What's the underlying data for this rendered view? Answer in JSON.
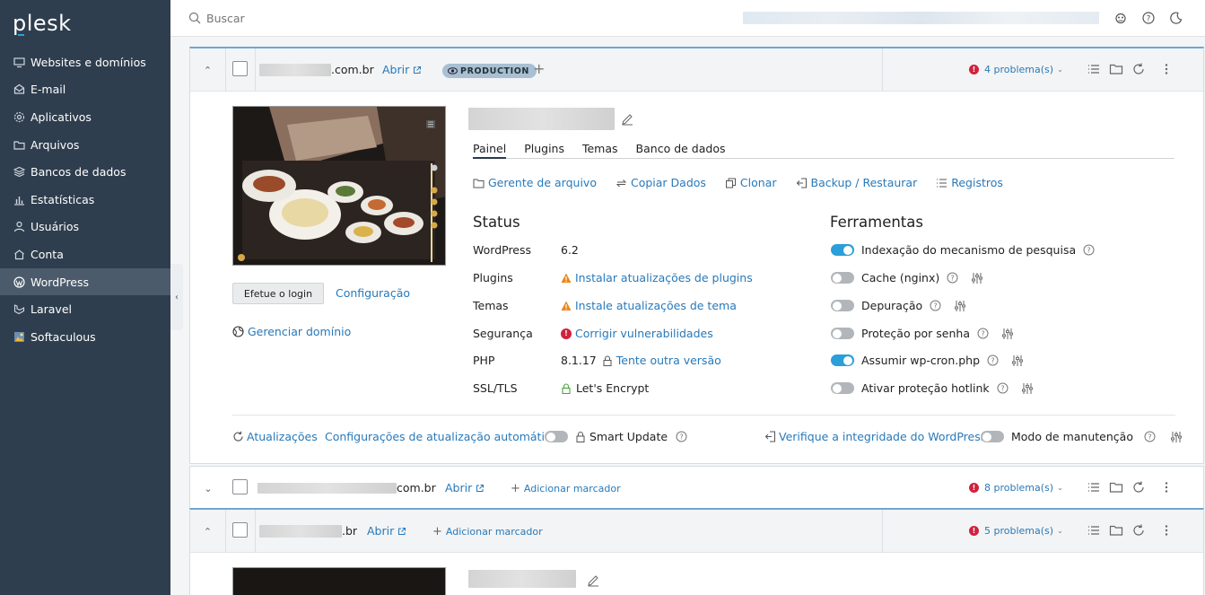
{
  "sidebar": {
    "logo": "plesk",
    "items": [
      {
        "label": "Websites e domínios",
        "icon": "monitor-icon"
      },
      {
        "label": "E-mail",
        "icon": "mail-icon"
      },
      {
        "label": "Aplicativos",
        "icon": "gear-icon"
      },
      {
        "label": "Arquivos",
        "icon": "folder-icon"
      },
      {
        "label": "Bancos de dados",
        "icon": "database-icon"
      },
      {
        "label": "Estatísticas",
        "icon": "bar-chart-icon"
      },
      {
        "label": "Usuários",
        "icon": "user-icon"
      },
      {
        "label": "Conta",
        "icon": "account-icon"
      },
      {
        "label": "WordPress",
        "icon": "wordpress-icon",
        "active": true
      },
      {
        "label": "Laravel",
        "icon": "laravel-icon"
      },
      {
        "label": "Softaculous",
        "icon": "softaculous-icon"
      }
    ]
  },
  "topbar": {
    "search_placeholder": "Buscar"
  },
  "site1": {
    "domain_suffix": ".com.br",
    "open_label": "Abrir",
    "badge": "PRODUCTION",
    "problems": "4 problema(s)",
    "login_button": "Efetue o login",
    "config_link": "Configuração",
    "manage_domain": "Gerenciar domínio",
    "tabs": [
      "Painel",
      "Plugins",
      "Temas",
      "Banco de dados"
    ],
    "actions": [
      "Gerente de arquivo",
      "Copiar Dados",
      "Clonar",
      "Backup / Restaurar",
      "Registros"
    ],
    "status": {
      "title": "Status",
      "rows": [
        {
          "label": "WordPress",
          "value": "6.2"
        },
        {
          "label": "Plugins",
          "value": "Instalar atualizações de plugins"
        },
        {
          "label": "Temas",
          "value": "Instale atualizações de tema"
        },
        {
          "label": "Segurança",
          "value": "Corrigir vulnerabilidades"
        },
        {
          "label": "PHP",
          "value": "8.1.17",
          "link": "Tente outra versão"
        },
        {
          "label": "SSL/TLS",
          "value": "Let's Encrypt"
        }
      ]
    },
    "tools": {
      "title": "Ferramentas",
      "rows": [
        {
          "label": "Indexação do mecanismo de pesquisa",
          "on": true
        },
        {
          "label": "Cache (nginx)",
          "on": false
        },
        {
          "label": "Depuração",
          "on": false
        },
        {
          "label": "Proteção por senha",
          "on": false
        },
        {
          "label": "Assumir wp-cron.php",
          "on": true
        },
        {
          "label": "Ativar proteção hotlink",
          "on": false
        }
      ]
    },
    "footer": {
      "updates": "Atualizações",
      "auto_update": "Configurações de atualização automática",
      "smart_update": "Smart Update",
      "integrity": "Verifique a integridade do WordPress",
      "maintenance": "Modo de manutenção"
    }
  },
  "site2": {
    "domain_suffix": "com.br",
    "open_label": "Abrir",
    "add_tag": "Adicionar marcador",
    "problems": "8 problema(s)"
  },
  "site3": {
    "domain_suffix": ".br",
    "open_label": "Abrir",
    "add_tag": "Adicionar marcador",
    "problems": "5 problema(s)"
  },
  "colors": {
    "sidebar_bg": "#2f3e4e",
    "sidebar_active": "#4b5b6c",
    "link": "#2879b9",
    "toggle_on": "#2a9fd9",
    "problem_red": "#d0223e",
    "warning_orange": "#e8891b",
    "ssl_green": "#4aa53b"
  }
}
